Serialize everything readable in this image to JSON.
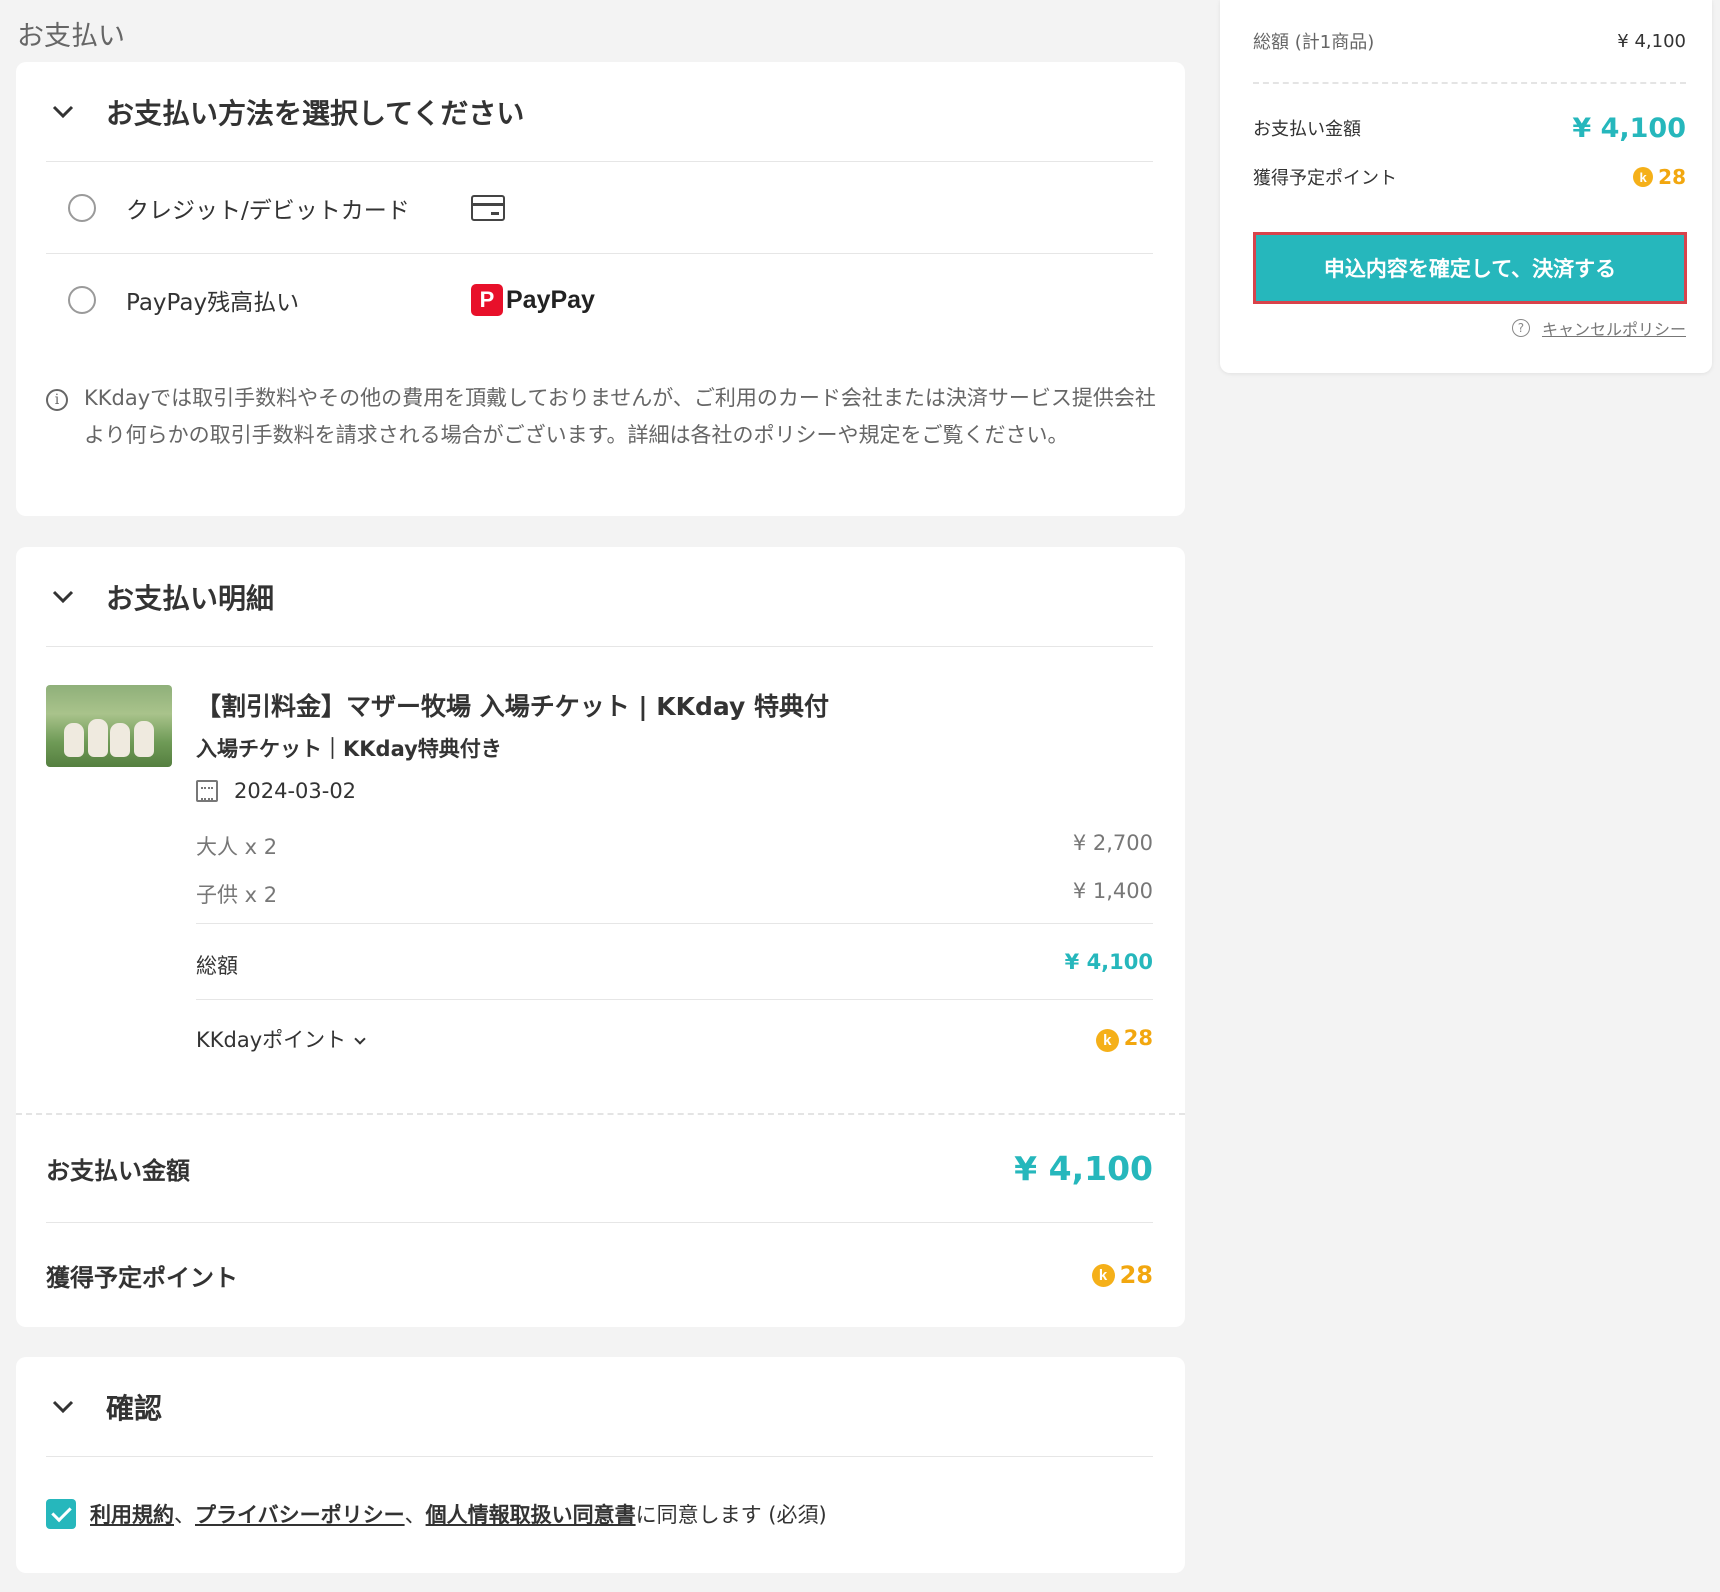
{
  "page": {
    "heading": "お支払い"
  },
  "payment_method": {
    "title": "お支払い方法を選択してください",
    "options": [
      {
        "label": "クレジット/デビットカード",
        "icon": "credit-card-icon"
      },
      {
        "label": "PayPay残高払い",
        "logo_text": "PayPay",
        "logo_mark": "P"
      }
    ],
    "notice": "KKdayでは取引手数料やその他の費用を頂戴しておりませんが、ご利用のカード会社または決済サービス提供会社より何らかの取引手数料を請求される場合がございます。詳細は各社のポリシーや規定をご覧ください。"
  },
  "detail": {
    "title": "お支払い明細",
    "product": {
      "title": "【割引料金】マザー牧場 入場チケット | KKday 特典付",
      "subtitle": "入場チケット｜KKday特典付き",
      "date": "2024-03-02"
    },
    "lines": [
      {
        "label": "大人 x 2",
        "price": "¥ 2,700"
      },
      {
        "label": "子供 x 2",
        "price": "¥ 1,400"
      }
    ],
    "total_label": "総額",
    "total_value": "¥ 4,100",
    "points_label": "KKdayポイント",
    "points_value": "28",
    "pay_amount_label": "お支払い金額",
    "pay_amount_value": "¥ 4,100",
    "earn_points_label": "獲得予定ポイント",
    "earn_points_value": "28"
  },
  "confirm": {
    "title": "確認",
    "links": [
      "利用規約",
      "プライバシーポリシー",
      "個人情報取扱い同意書"
    ],
    "separator": "、",
    "suffix": "に同意します (必須)",
    "checked": true
  },
  "summary": {
    "total_label": "総額 (計1商品)",
    "total_value": "¥ 4,100",
    "pay_label": "お支払い金額",
    "pay_value": "¥ 4,100",
    "points_label": "獲得予定ポイント",
    "points_value": "28",
    "cta_label": "申込内容を確定して、決済する",
    "cancel_policy": "キャンセルポリシー"
  },
  "coin_letter": "k",
  "colors": {
    "accent": "#26b7bc",
    "points": "#f2a70f",
    "cta_border": "#d8434b",
    "paypay": "#e8102a"
  }
}
